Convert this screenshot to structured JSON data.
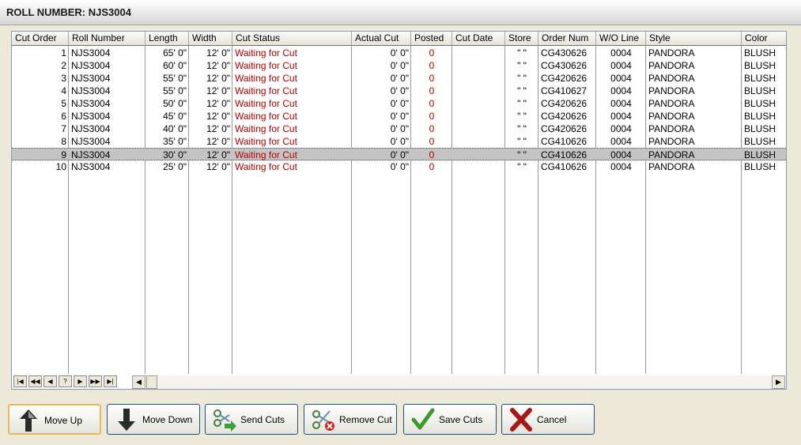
{
  "window": {
    "title": "ROLL NUMBER: NJS3004"
  },
  "grid": {
    "columns": [
      "Cut Order",
      "Roll Number",
      "Length",
      "Width",
      "Cut Status",
      "Actual Cut",
      "Posted",
      "Cut Date",
      "Store",
      "Order Num",
      "W/O Line",
      "Style",
      "Color"
    ],
    "rows": [
      [
        "1",
        "NJS3004",
        "65' 0\"",
        "12' 0\"",
        "Waiting for Cut",
        "0' 0\"",
        "0",
        "",
        "\" \"",
        "CG430626",
        "0004",
        "PANDORA",
        "BLUSH"
      ],
      [
        "2",
        "NJS3004",
        "60' 0\"",
        "12' 0\"",
        "Waiting for Cut",
        "0' 0\"",
        "0",
        "",
        "\" \"",
        "CG430626",
        "0004",
        "PANDORA",
        "BLUSH"
      ],
      [
        "3",
        "NJS3004",
        "55' 0\"",
        "12' 0\"",
        "Waiting for Cut",
        "0' 0\"",
        "0",
        "",
        "\" \"",
        "CG420626",
        "0004",
        "PANDORA",
        "BLUSH"
      ],
      [
        "4",
        "NJS3004",
        "55' 0\"",
        "12' 0\"",
        "Waiting for Cut",
        "0' 0\"",
        "0",
        "",
        "\" \"",
        "CG410627",
        "0004",
        "PANDORA",
        "BLUSH"
      ],
      [
        "5",
        "NJS3004",
        "50' 0\"",
        "12' 0\"",
        "Waiting for Cut",
        "0' 0\"",
        "0",
        "",
        "\" \"",
        "CG420626",
        "0004",
        "PANDORA",
        "BLUSH"
      ],
      [
        "6",
        "NJS3004",
        "45' 0\"",
        "12' 0\"",
        "Waiting for Cut",
        "0' 0\"",
        "0",
        "",
        "\" \"",
        "CG420626",
        "0004",
        "PANDORA",
        "BLUSH"
      ],
      [
        "7",
        "NJS3004",
        "40' 0\"",
        "12' 0\"",
        "Waiting for Cut",
        "0' 0\"",
        "0",
        "",
        "\" \"",
        "CG420626",
        "0004",
        "PANDORA",
        "BLUSH"
      ],
      [
        "8",
        "NJS3004",
        "35' 0\"",
        "12' 0\"",
        "Waiting for Cut",
        "0' 0\"",
        "0",
        "",
        "\" \"",
        "CG410626",
        "0004",
        "PANDORA",
        "BLUSH"
      ],
      [
        "9",
        "NJS3004",
        "30' 0\"",
        "12' 0\"",
        "Waiting for Cut",
        "0' 0\"",
        "0",
        "",
        "\" \"",
        "CG410626",
        "0004",
        "PANDORA",
        "BLUSH"
      ],
      [
        "10",
        "NJS3004",
        "25' 0\"",
        "12' 0\"",
        "Waiting for Cut",
        "0' 0\"",
        "0",
        "",
        "\" \"",
        "CG410626",
        "0004",
        "PANDORA",
        "BLUSH"
      ]
    ],
    "selected_row": 9,
    "nav": [
      "|◀",
      "◀◀",
      "◀",
      "?",
      "▶",
      "▶▶",
      "▶|"
    ]
  },
  "buttons": {
    "move_up": "Move Up",
    "move_down": "Move Down",
    "send_cuts": "Send Cuts",
    "remove_cut": "Remove Cut",
    "save_cuts": "Save Cuts",
    "cancel": "Cancel"
  },
  "colors": {
    "status_text": "#b30000",
    "posted_text": "#b30000",
    "selected_row": "#c4c4c4"
  }
}
